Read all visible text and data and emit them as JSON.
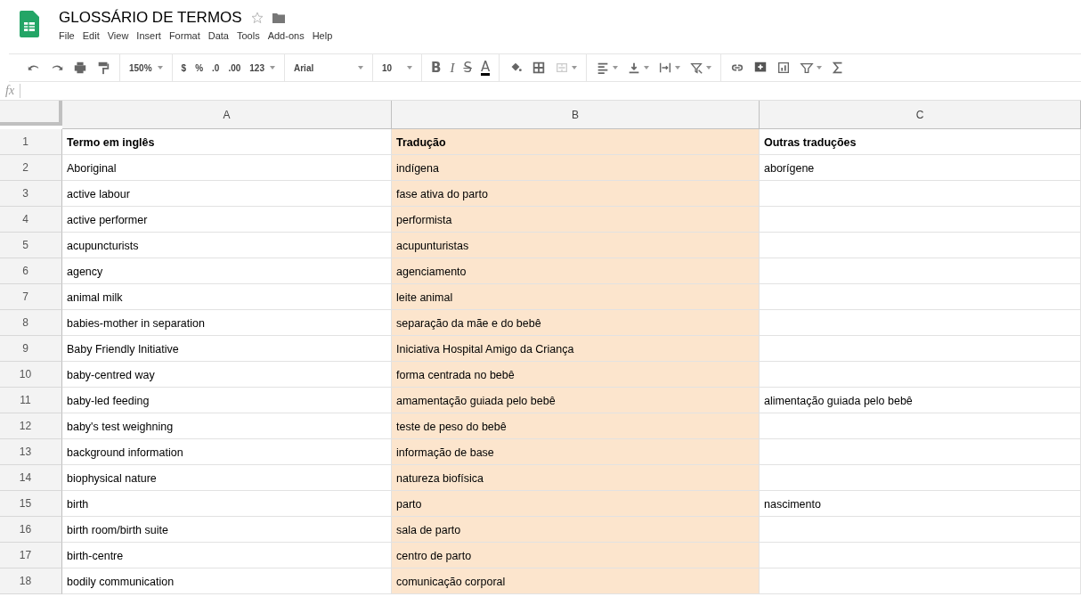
{
  "document": {
    "title": "GLOSSÁRIO DE TERMOS"
  },
  "menu": [
    "File",
    "Edit",
    "View",
    "Insert",
    "Format",
    "Data",
    "Tools",
    "Add-ons",
    "Help"
  ],
  "toolbar": [
    {
      "kind": "undo"
    },
    {
      "kind": "redo"
    },
    {
      "kind": "print"
    },
    {
      "kind": "paint"
    },
    {
      "kind": "sep"
    },
    {
      "kind": "dropdown",
      "label": "150%"
    },
    {
      "kind": "sep"
    },
    {
      "kind": "text",
      "label": "$"
    },
    {
      "kind": "text",
      "label": "%"
    },
    {
      "kind": "text",
      "label": ".0"
    },
    {
      "kind": "text",
      "label": ".00"
    },
    {
      "kind": "dropdown",
      "label": "123"
    },
    {
      "kind": "sep"
    },
    {
      "kind": "font",
      "label": "Arial"
    },
    {
      "kind": "sep"
    },
    {
      "kind": "font-size",
      "label": "10"
    },
    {
      "kind": "sep"
    },
    {
      "kind": "bold",
      "label": "B"
    },
    {
      "kind": "italic",
      "label": "I"
    },
    {
      "kind": "strike",
      "label": "S"
    },
    {
      "kind": "color-text",
      "label": "A"
    },
    {
      "kind": "sep"
    },
    {
      "kind": "fill"
    },
    {
      "kind": "borders"
    },
    {
      "kind": "merge"
    },
    {
      "kind": "sep"
    },
    {
      "kind": "align"
    },
    {
      "kind": "valign"
    },
    {
      "kind": "wrap"
    },
    {
      "kind": "rotate"
    },
    {
      "kind": "sep"
    },
    {
      "kind": "link"
    },
    {
      "kind": "comment"
    },
    {
      "kind": "chart"
    },
    {
      "kind": "filter"
    },
    {
      "kind": "sum"
    }
  ],
  "formula_bar": {
    "label": "fx"
  },
  "columns": [
    {
      "label": "A"
    },
    {
      "label": "B",
      "color": "#fce5cd"
    },
    {
      "label": "C"
    }
  ],
  "rows": [
    {
      "number": "1",
      "bold": true,
      "cells": [
        "Termo em inglês",
        "Tradução",
        "Outras traduções"
      ]
    },
    {
      "number": "2",
      "bold": false,
      "cells": [
        "Aboriginal",
        "indígena",
        "aborígene"
      ]
    },
    {
      "number": "3",
      "bold": false,
      "cells": [
        "active labour",
        "fase ativa do parto",
        ""
      ]
    },
    {
      "number": "4",
      "bold": false,
      "cells": [
        "active performer",
        "performista",
        ""
      ]
    },
    {
      "number": "5",
      "bold": false,
      "cells": [
        "acupuncturists",
        "acupunturistas",
        ""
      ]
    },
    {
      "number": "6",
      "bold": false,
      "cells": [
        "agency",
        "agenciamento",
        ""
      ]
    },
    {
      "number": "7",
      "bold": false,
      "cells": [
        "animal milk",
        "leite animal",
        ""
      ]
    },
    {
      "number": "8",
      "bold": false,
      "cells": [
        "babies-mother in separation",
        "separação da mãe e do bebê",
        ""
      ]
    },
    {
      "number": "9",
      "bold": false,
      "cells": [
        "Baby Friendly Initiative",
        "Iniciativa Hospital Amigo da Criança",
        ""
      ]
    },
    {
      "number": "10",
      "bold": false,
      "cells": [
        "baby-centred way",
        "forma centrada no bebê",
        ""
      ]
    },
    {
      "number": "11",
      "bold": false,
      "cells": [
        "baby-led feeding",
        "amamentação guiada pelo bebê",
        "alimentação guiada pelo bebê"
      ]
    },
    {
      "number": "12",
      "bold": false,
      "cells": [
        "baby's test weighning",
        "teste de peso do bebê",
        ""
      ]
    },
    {
      "number": "13",
      "bold": false,
      "cells": [
        "background information",
        "informação de base",
        ""
      ]
    },
    {
      "number": "14",
      "bold": false,
      "cells": [
        "biophysical nature",
        "natureza biofísica",
        ""
      ]
    },
    {
      "number": "15",
      "bold": false,
      "cells": [
        "birth",
        "parto",
        "nascimento"
      ]
    },
    {
      "number": "16",
      "bold": false,
      "cells": [
        "birth room/birth suite",
        "sala de parto",
        ""
      ]
    },
    {
      "number": "17",
      "bold": false,
      "cells": [
        "birth-centre",
        "centro de parto",
        ""
      ]
    },
    {
      "number": "18",
      "bold": false,
      "cells": [
        "bodily communication",
        "comunicação corporal",
        ""
      ]
    }
  ]
}
